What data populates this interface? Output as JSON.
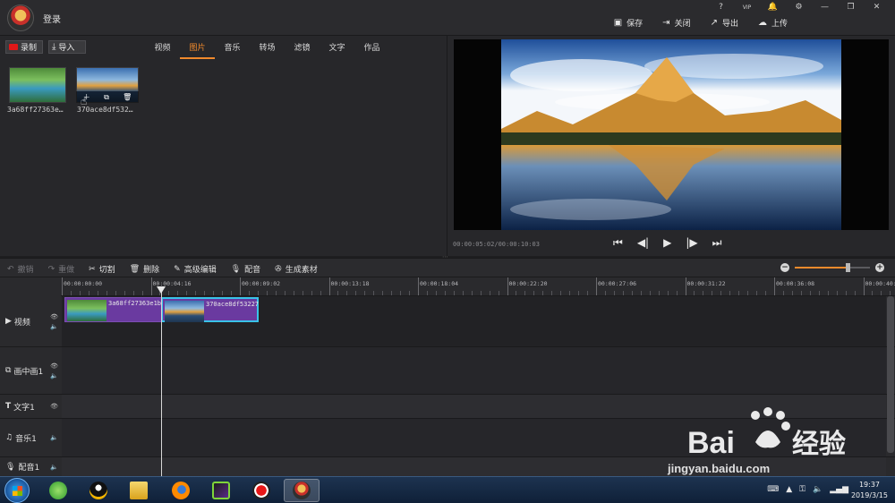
{
  "titlebar": {
    "login": "登录",
    "win_controls": [
      "?",
      "VIP",
      "🔔",
      "⚙",
      "—",
      "❐",
      "✕"
    ],
    "actions": [
      {
        "icon": "save-icon",
        "label": "保存"
      },
      {
        "icon": "close-doc-icon",
        "label": "关闭"
      },
      {
        "icon": "export-icon",
        "label": "导出"
      },
      {
        "icon": "upload-icon",
        "label": "上传"
      }
    ]
  },
  "library": {
    "record_label": "录制",
    "import_label": "导入",
    "tabs": [
      "视频",
      "图片",
      "音乐",
      "转场",
      "滤镜",
      "文字",
      "作品"
    ],
    "active_tab": "图片",
    "items": [
      {
        "name": "3a68ff27363e…"
      },
      {
        "name": "370ace8df532…"
      }
    ]
  },
  "preview": {
    "time": "00:00:05:02/00:00:10:03"
  },
  "edit_toolbar": {
    "undo": "撤销",
    "redo": "重做",
    "cut": "切割",
    "delete": "删除",
    "advanced": "高级编辑",
    "dub": "配音",
    "generate": "生成素材",
    "zoom_level": 0.7
  },
  "timeline": {
    "ticks": [
      "00:00:00:00",
      "00:00:04:16",
      "00:00:09:02",
      "00:00:13:18",
      "00:00:18:04",
      "00:00:22:20",
      "00:00:27:06",
      "00:00:31:22",
      "00:00:36:08",
      "00:00:40:2"
    ],
    "tracks": [
      {
        "label": "视频"
      },
      {
        "label": "画中画1"
      },
      {
        "label": "文字1"
      },
      {
        "label": "音乐1"
      },
      {
        "label": "配音1"
      }
    ],
    "clips": [
      {
        "name": "3a68ff27363e1b"
      },
      {
        "name": "370ace8df53227"
      }
    ]
  },
  "taskbar": {
    "time": "19:37",
    "date": "2019/3/15"
  },
  "watermark": {
    "brand": "Bai du 经验",
    "url": "jingyan.baidu.com"
  }
}
